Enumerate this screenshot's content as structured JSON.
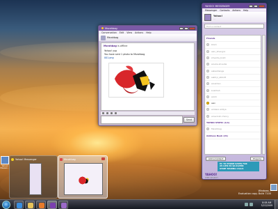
{
  "chat": {
    "title": "Msrahbag",
    "menu": [
      "Conversation",
      "Edit",
      "View",
      "Actions",
      "Help"
    ],
    "toolbar_name": "Msrahbag",
    "status_name": "Msrahbag",
    "status_text": "is offline",
    "incoming_label": "Yahoo! yup",
    "file_notice": "You have sent 1 photo to Msrahbag",
    "file_name": "001.png",
    "send_label": "Send"
  },
  "messenger": {
    "title": "YAHOO! MESSENGER",
    "menu": [
      "Messenger",
      "Contacts",
      "Actions",
      "Help"
    ],
    "user_name": "Yahoo!",
    "user_status": "...",
    "search_placeholder": "Find a contact",
    "contacts": [
      {
        "name": "Friends",
        "state": "group"
      },
      {
        "name": "kevin",
        "state": "offline"
      },
      {
        "name": "asin_bhangra",
        "state": "offline"
      },
      {
        "name": "shvedia_bosti",
        "state": "offline"
      },
      {
        "name": "sinelia.shvedia",
        "state": "offline"
      },
      {
        "name": "sabastiange",
        "state": "offline"
      },
      {
        "name": "sabhyi_abbott",
        "state": "offline"
      },
      {
        "name": "sinakhan",
        "state": "offline"
      },
      {
        "name": "kvalihah",
        "state": "offline"
      },
      {
        "name": "sinkh",
        "state": "offline"
      },
      {
        "name": "asin",
        "state": "online"
      },
      {
        "name": "ambani.aditya",
        "state": "offline"
      },
      {
        "name": "americah.chinny",
        "state": "offline"
      },
      {
        "name": "YAHOO STATIC (1/1)",
        "state": "group"
      },
      {
        "name": "Msrahbag",
        "state": "offline"
      },
      {
        "name": "Address Book (21)",
        "state": "group"
      }
    ],
    "add_contact_label": "Add a Contact",
    "plugin_label": "Plug-ins",
    "ad_lines": [
      "PC TO PHONE RATES FOR",
      "AS LOW AS $0.01/MIN",
      "START MAKING CALLS"
    ],
    "logo": "YAHOO!",
    "websearch_label": "WEB SEARCH"
  },
  "thumbnails": [
    {
      "label": "Yahoo! Messenger",
      "active": false
    },
    {
      "label": "Msrahbag",
      "active": true
    }
  ],
  "desktop": {
    "left_icon_label": "Yahoo! Messen...",
    "watermark_line1": "Windows 7",
    "watermark_line2": "Evaluation copy. Build 7100",
    "watermark_line3": ""
  },
  "taskbar": {
    "time": "8:08 AM",
    "date": "5/22/2009"
  },
  "colors": {
    "yahoo_purple": "#5b2c8f",
    "online": "#f4c320",
    "ad_blue": "#2c9ab8"
  }
}
